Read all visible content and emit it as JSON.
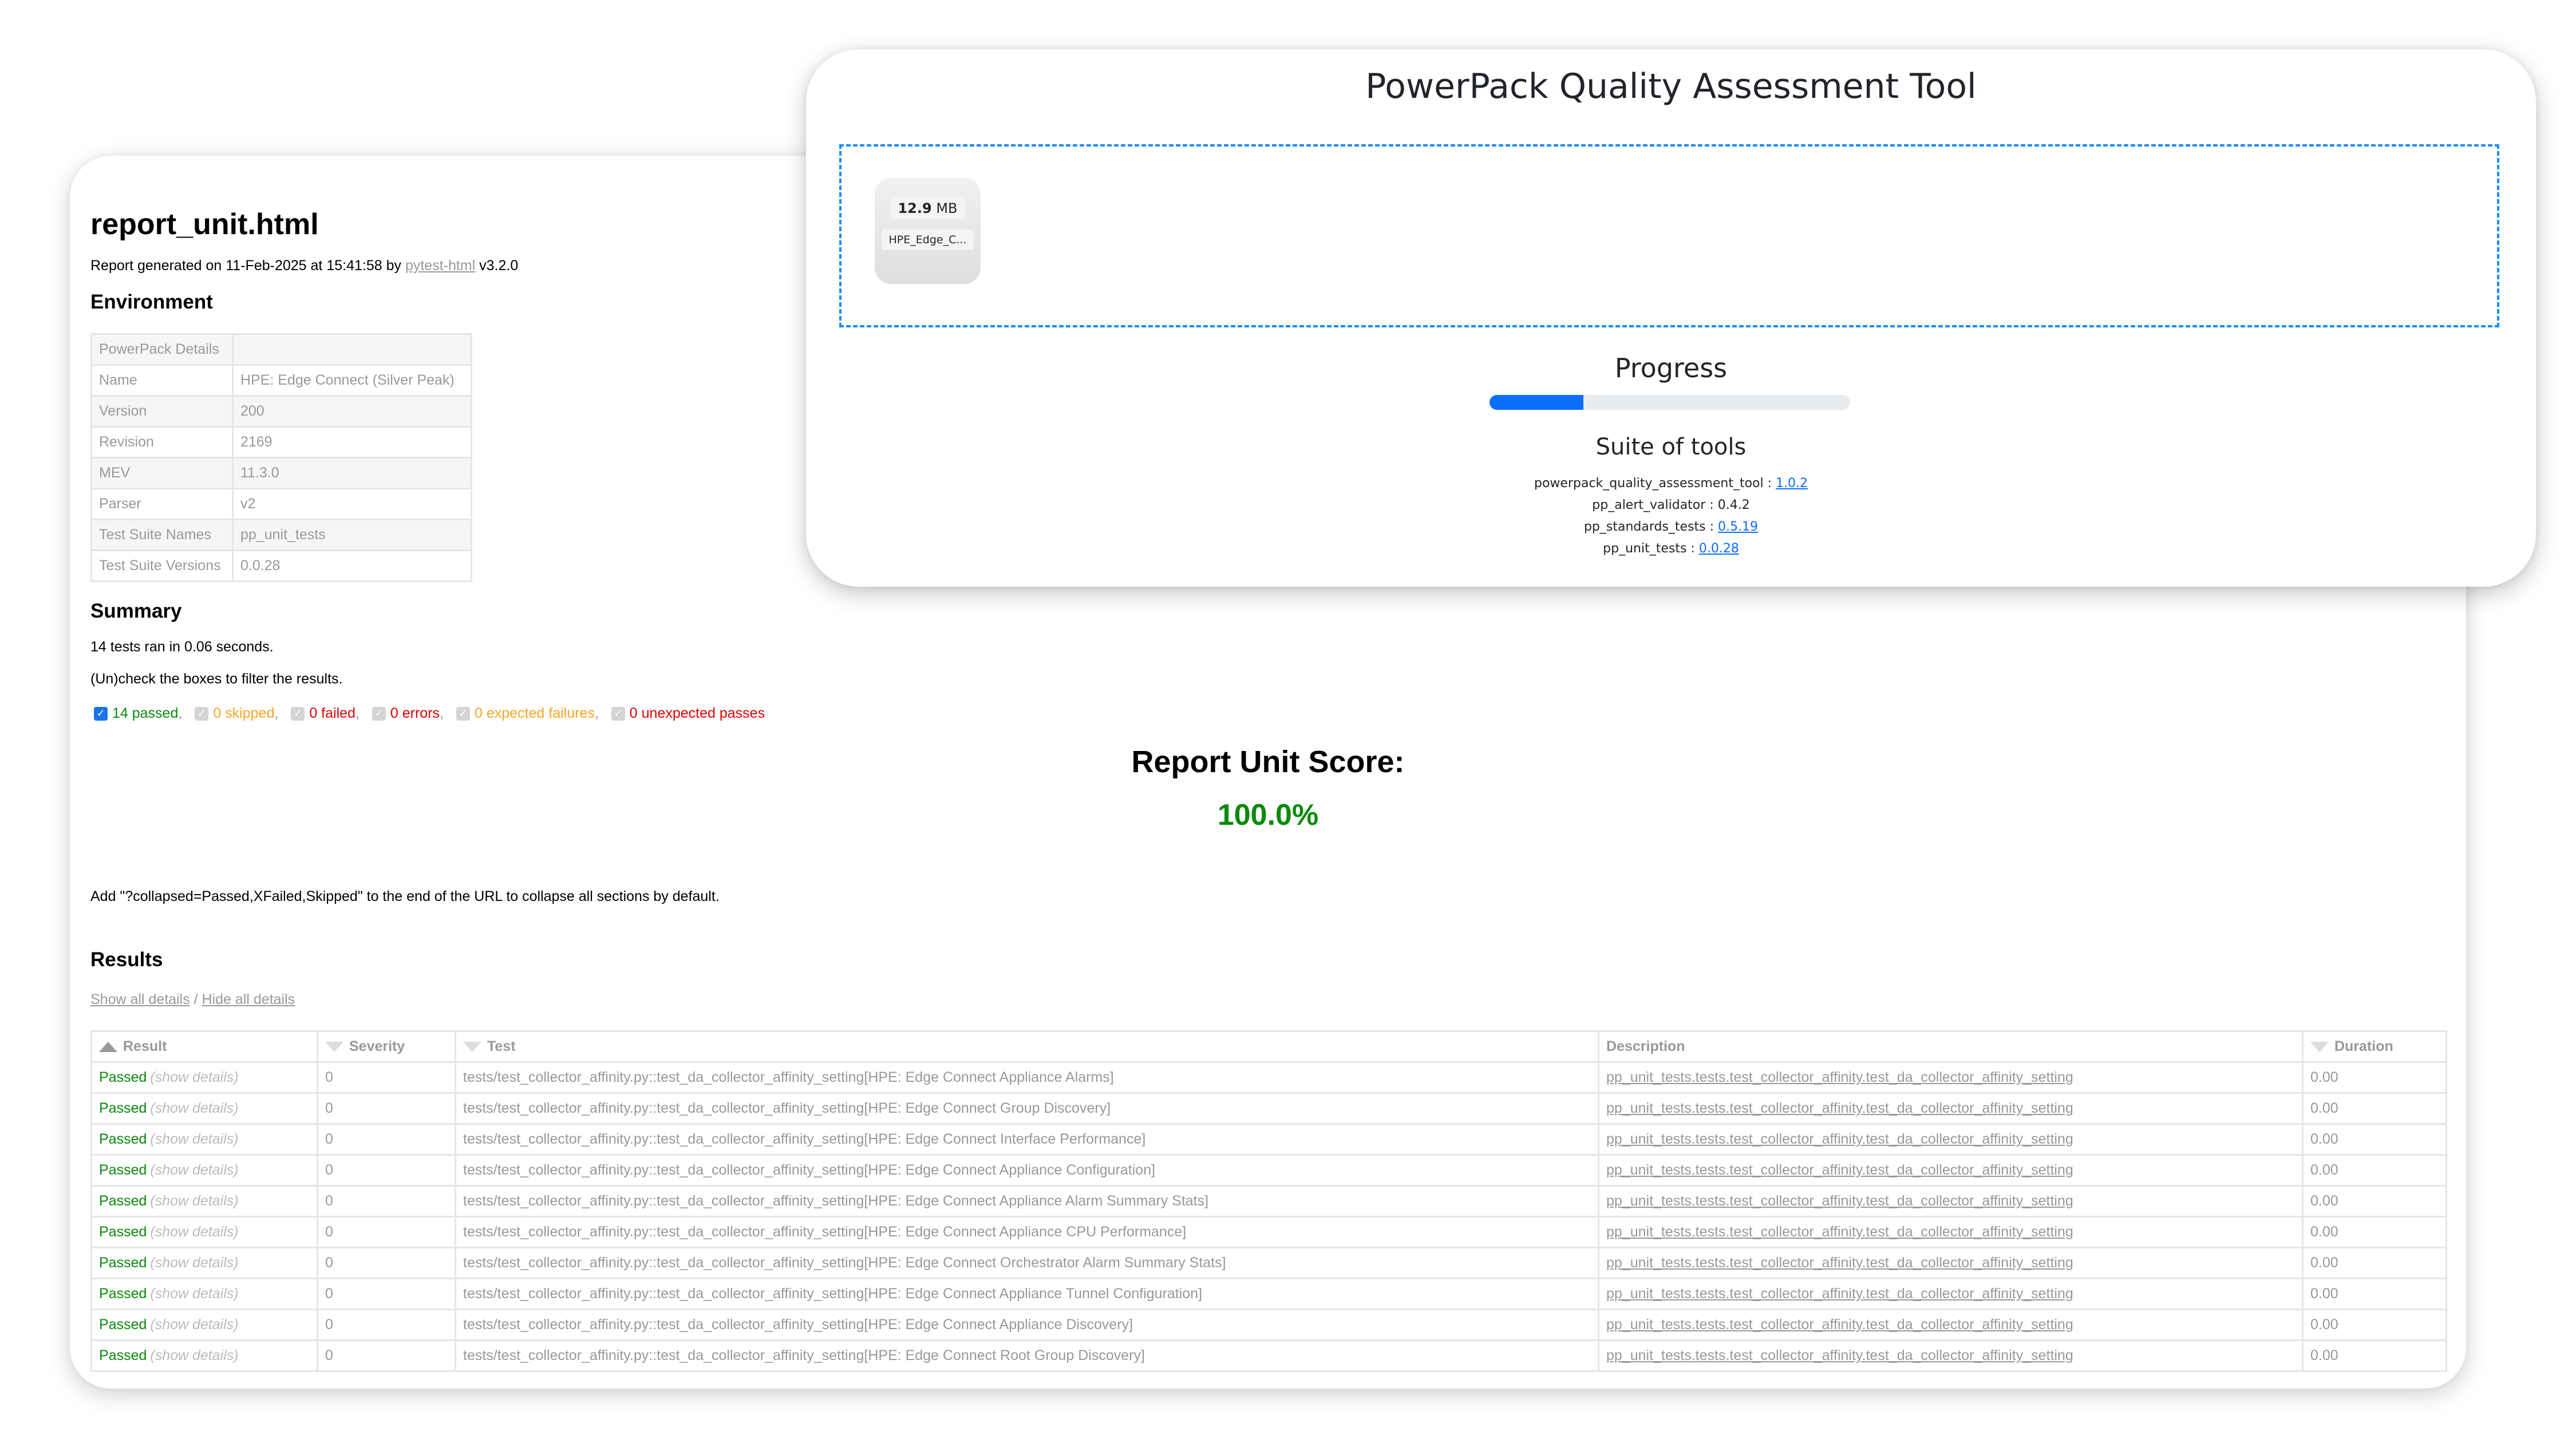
{
  "report": {
    "title": "report_unit.html",
    "generated_prefix": "Report generated on 11-Feb-2025 at 15:41:58 by ",
    "generated_link": "pytest-html",
    "generated_suffix": " v3.2.0",
    "environment_heading": "Environment",
    "environment": [
      {
        "key": "PowerPack Details",
        "value": ""
      },
      {
        "key": "Name",
        "value": "HPE: Edge Connect (Silver Peak)"
      },
      {
        "key": "Version",
        "value": "200"
      },
      {
        "key": "Revision",
        "value": "2169"
      },
      {
        "key": "MEV",
        "value": "11.3.0"
      },
      {
        "key": "Parser",
        "value": "v2"
      },
      {
        "key": "Test Suite Names",
        "value": "pp_unit_tests"
      },
      {
        "key": "Test Suite Versions",
        "value": "0.0.28"
      }
    ],
    "summary_heading": "Summary",
    "summary_ran": "14 tests ran in 0.06 seconds.",
    "summary_hint": "(Un)check the boxes to filter the results.",
    "filters": [
      {
        "label": "14 passed",
        "checked": true,
        "color": "#0a8a0a"
      },
      {
        "label": "0 skipped",
        "checked": false,
        "color": "#f5a623"
      },
      {
        "label": "0 failed",
        "checked": false,
        "color": "#e00000"
      },
      {
        "label": "0 errors",
        "checked": false,
        "color": "#e00000"
      },
      {
        "label": "0 expected failures",
        "checked": false,
        "color": "#f5a623"
      },
      {
        "label": "0 unexpected passes",
        "checked": false,
        "color": "#e00000"
      }
    ],
    "score_label": "Report Unit Score:",
    "score_value": "100.0%",
    "collapse_note": "Add \"?collapsed=Passed,XFailed,Skipped\" to the end of the URL to collapse all sections by default.",
    "results_heading": "Results",
    "show_all": "Show all details",
    "separator": " / ",
    "hide_all": "Hide all details",
    "columns": [
      "Result",
      "Severity",
      "Test",
      "Description",
      "Duration"
    ],
    "rows": [
      {
        "result": "Passed",
        "details": "(show details)",
        "severity": "0",
        "test": "tests/test_collector_affinity.py::test_da_collector_affinity_setting[HPE: Edge Connect Appliance Alarms]",
        "description": "pp_unit_tests.tests.test_collector_affinity.test_da_collector_affinity_setting",
        "duration": "0.00"
      },
      {
        "result": "Passed",
        "details": "(show details)",
        "severity": "0",
        "test": "tests/test_collector_affinity.py::test_da_collector_affinity_setting[HPE: Edge Connect Group Discovery]",
        "description": "pp_unit_tests.tests.test_collector_affinity.test_da_collector_affinity_setting",
        "duration": "0.00"
      },
      {
        "result": "Passed",
        "details": "(show details)",
        "severity": "0",
        "test": "tests/test_collector_affinity.py::test_da_collector_affinity_setting[HPE: Edge Connect Interface Performance]",
        "description": "pp_unit_tests.tests.test_collector_affinity.test_da_collector_affinity_setting",
        "duration": "0.00"
      },
      {
        "result": "Passed",
        "details": "(show details)",
        "severity": "0",
        "test": "tests/test_collector_affinity.py::test_da_collector_affinity_setting[HPE: Edge Connect Appliance Configuration]",
        "description": "pp_unit_tests.tests.test_collector_affinity.test_da_collector_affinity_setting",
        "duration": "0.00"
      },
      {
        "result": "Passed",
        "details": "(show details)",
        "severity": "0",
        "test": "tests/test_collector_affinity.py::test_da_collector_affinity_setting[HPE: Edge Connect Appliance Alarm Summary Stats]",
        "description": "pp_unit_tests.tests.test_collector_affinity.test_da_collector_affinity_setting",
        "duration": "0.00"
      },
      {
        "result": "Passed",
        "details": "(show details)",
        "severity": "0",
        "test": "tests/test_collector_affinity.py::test_da_collector_affinity_setting[HPE: Edge Connect Appliance CPU Performance]",
        "description": "pp_unit_tests.tests.test_collector_affinity.test_da_collector_affinity_setting",
        "duration": "0.00"
      },
      {
        "result": "Passed",
        "details": "(show details)",
        "severity": "0",
        "test": "tests/test_collector_affinity.py::test_da_collector_affinity_setting[HPE: Edge Connect Orchestrator Alarm Summary Stats]",
        "description": "pp_unit_tests.tests.test_collector_affinity.test_da_collector_affinity_setting",
        "duration": "0.00"
      },
      {
        "result": "Passed",
        "details": "(show details)",
        "severity": "0",
        "test": "tests/test_collector_affinity.py::test_da_collector_affinity_setting[HPE: Edge Connect Appliance Tunnel Configuration]",
        "description": "pp_unit_tests.tests.test_collector_affinity.test_da_collector_affinity_setting",
        "duration": "0.00"
      },
      {
        "result": "Passed",
        "details": "(show details)",
        "severity": "0",
        "test": "tests/test_collector_affinity.py::test_da_collector_affinity_setting[HPE: Edge Connect Appliance Discovery]",
        "description": "pp_unit_tests.tests.test_collector_affinity.test_da_collector_affinity_setting",
        "duration": "0.00"
      },
      {
        "result": "Passed",
        "details": "(show details)",
        "severity": "0",
        "test": "tests/test_collector_affinity.py::test_da_collector_affinity_setting[HPE: Edge Connect Root Group Discovery]",
        "description": "pp_unit_tests.tests.test_collector_affinity.test_da_collector_affinity_setting",
        "duration": "0.00"
      }
    ]
  },
  "tool": {
    "title": "PowerPack Quality Assessment Tool",
    "file": {
      "size_value": "12.9",
      "size_unit": " MB",
      "name": "HPE_Edge_C..."
    },
    "progress_label": "Progress",
    "progress_percent": 26,
    "progress_color": "#0d6efd",
    "suite_heading": "Suite of tools",
    "suite": [
      {
        "name": "powerpack_quality_assessment_tool",
        "version": "1.0.2",
        "linked": true
      },
      {
        "name": "pp_alert_validator",
        "version": "0.4.2",
        "linked": false
      },
      {
        "name": "pp_standards_tests",
        "version": "0.5.19",
        "linked": true
      },
      {
        "name": "pp_unit_tests",
        "version": "0.0.28",
        "linked": true
      }
    ]
  }
}
